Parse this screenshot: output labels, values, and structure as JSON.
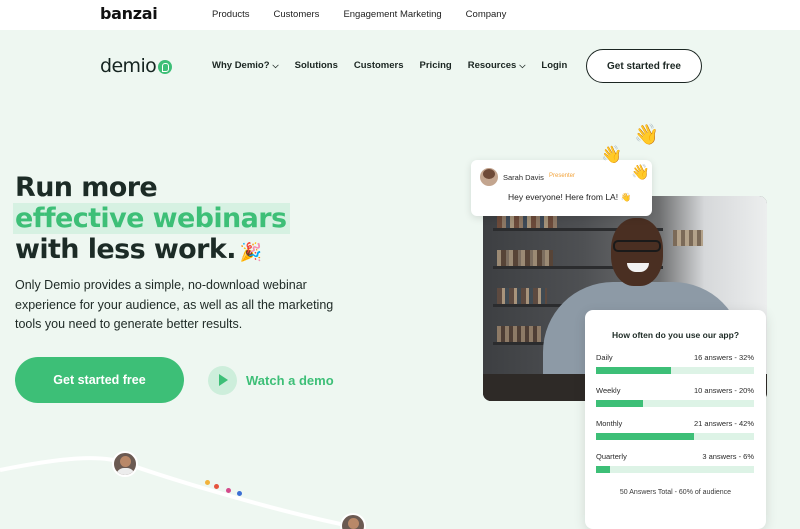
{
  "topbar": {
    "logo": "banzai",
    "nav": [
      "Products",
      "Customers",
      "Engagement Marketing",
      "Company"
    ]
  },
  "nav": {
    "logo": "demio",
    "items": [
      {
        "label": "Why Demio?",
        "has_dropdown": true
      },
      {
        "label": "Solutions",
        "has_dropdown": false
      },
      {
        "label": "Customers",
        "has_dropdown": false
      },
      {
        "label": "Pricing",
        "has_dropdown": false
      },
      {
        "label": "Resources",
        "has_dropdown": true
      },
      {
        "label": "Login",
        "has_dropdown": false
      }
    ],
    "cta": "Get started free"
  },
  "hero": {
    "line1": "Run more",
    "line2": "effective webinars",
    "line3": "with less work.",
    "confetti_icon": "🎉",
    "subcopy": "Only Demio provides a simple, no-download webinar experience for your audience, as well as all the marketing tools you need to generate better results.",
    "cta_primary": "Get started free",
    "cta_secondary": "Watch a demo"
  },
  "chat": {
    "name": "Sarah Davis",
    "badge": "Presenter",
    "message": "Hey everyone! Here from LA!",
    "wave_icon": "👋"
  },
  "poll": {
    "question": "How often do you use our app?",
    "options": [
      {
        "label": "Daily",
        "count": "16 answers - 32%",
        "percent": 32
      },
      {
        "label": "Weekly",
        "count": "10 answers - 20%",
        "percent": 20
      },
      {
        "label": "Monthly",
        "count": "21 answers - 42%",
        "percent": 42
      },
      {
        "label": "Quarterly",
        "count": "3 answers - 6%",
        "percent": 6
      }
    ],
    "total": "50 Answers Total - 60% of audience"
  },
  "colors": {
    "accent": "#3dbf77",
    "background": "#eef7f1",
    "highlight": "#d6f1e2",
    "dark": "#1c2b26"
  }
}
